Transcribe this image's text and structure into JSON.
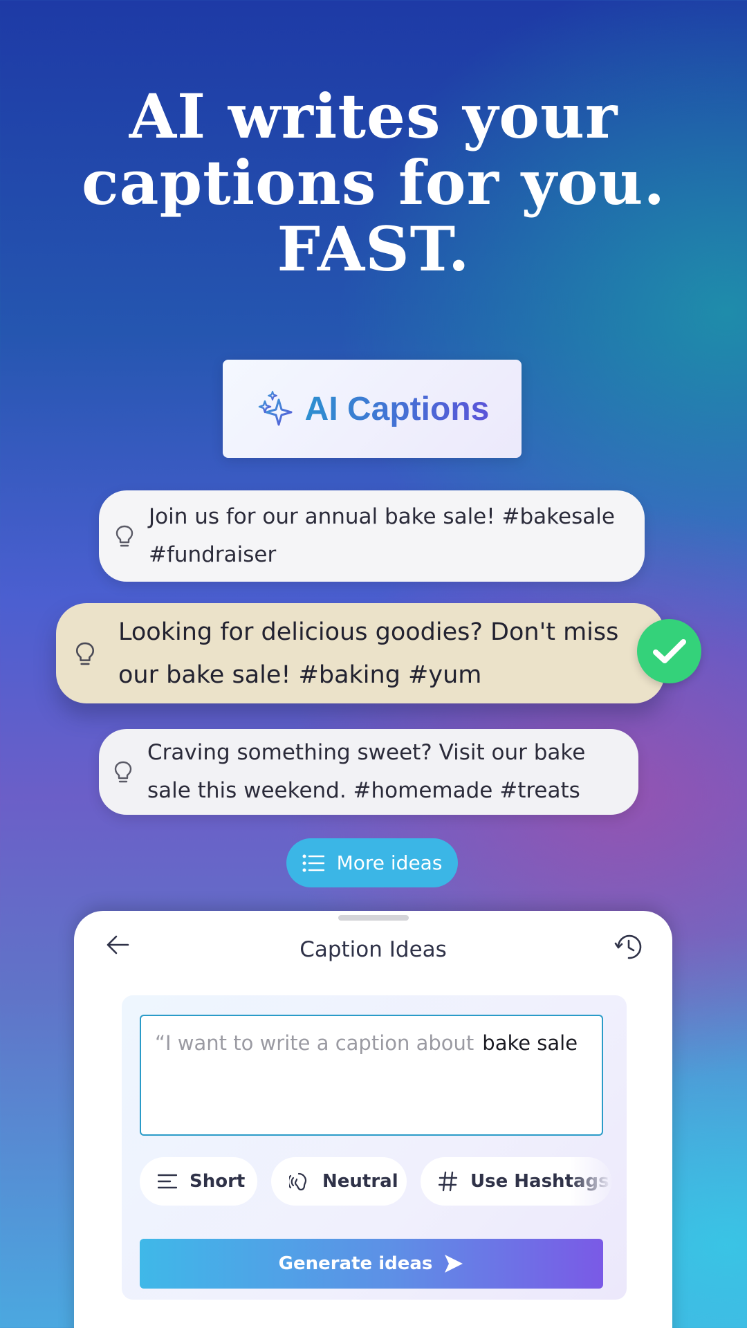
{
  "headline": {
    "line1": "AI writes your",
    "line2": "captions for you.",
    "line3": "FAST."
  },
  "badge": {
    "label": "AI Captions",
    "icon": "sparkles-icon"
  },
  "captions": [
    {
      "text": "Join us for our annual bake sale! #bakesale #fundraiser",
      "selected": false
    },
    {
      "text": "Looking for delicious goodies? Don't miss our bake sale! #baking #yum",
      "selected": true
    },
    {
      "text": "Craving something sweet? Visit our bake sale this weekend. #homemade #treats",
      "selected": false
    }
  ],
  "more_ideas": {
    "label": "More ideas",
    "icon": "list-icon"
  },
  "sheet": {
    "title": "Caption Ideas",
    "back_icon": "arrow-left-icon",
    "history_icon": "history-icon",
    "prompt": {
      "prefix": "“I want to write a caption about",
      "value": "bake sale"
    },
    "options": {
      "length": "Short",
      "tone": "Neutral",
      "hashtags": "Use Hashtags"
    },
    "generate_label": "Generate ideas"
  },
  "colors": {
    "selected_card": "#ebe2c9",
    "check": "#34d27a",
    "more_ideas": "#3bb6e6",
    "prompt_border": "#2a9bc8"
  }
}
